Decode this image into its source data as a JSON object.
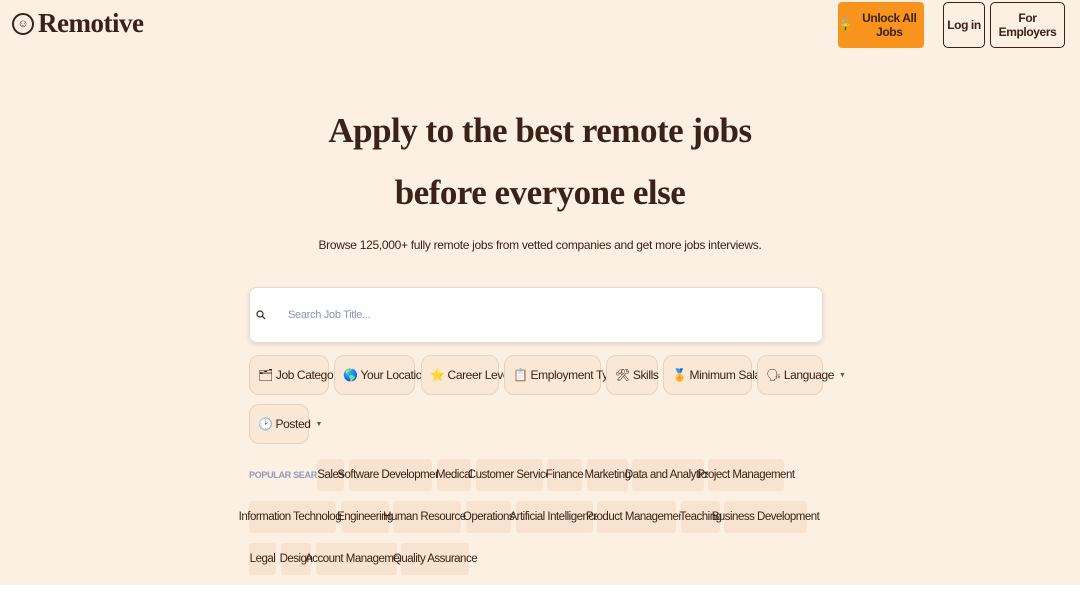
{
  "header": {
    "logo_text": "Remotive",
    "unlock_label": "Unlock All Jobs",
    "login_label": "Log in",
    "employers_label": "For Employers"
  },
  "hero": {
    "title_line1": "Apply to the best remote jobs",
    "title_line2": "before everyone else",
    "subtitle": "Browse 125,000+ fully remote jobs from vetted companies and get more jobs interviews."
  },
  "search": {
    "placeholder": "Search Job Title..."
  },
  "filters": [
    {
      "label": "Job Category",
      "icon": "folder-icon"
    },
    {
      "label": "Your Location",
      "icon": "globe-icon"
    },
    {
      "label": "Career Level",
      "icon": "star-icon"
    },
    {
      "label": "Employment Type",
      "icon": "clipboard-icon"
    },
    {
      "label": "Skills",
      "icon": "tools-icon"
    },
    {
      "label": "Minimum Salary",
      "icon": "medal-icon"
    },
    {
      "label": "Language",
      "icon": "speaking-head-icon"
    },
    {
      "label": "Posted",
      "icon": "clock-icon"
    }
  ],
  "popular": {
    "label": "POPULAR SEARCHES:",
    "tags": [
      "Sales",
      "Software Development",
      "Medical",
      "Customer Service",
      "Finance",
      "Marketing",
      "Data and Analytics",
      "Project Management",
      "Information Technology",
      "Engineering",
      "Human Resources",
      "Operations",
      "Artificial Intelligence",
      "Product Management",
      "Teaching",
      "Business Development",
      "Legal",
      "Design",
      "Account Management",
      "Quality Assurance"
    ]
  },
  "colors": {
    "background": "#fcf0e3",
    "accent": "#f8941e",
    "text": "#3b2217"
  }
}
